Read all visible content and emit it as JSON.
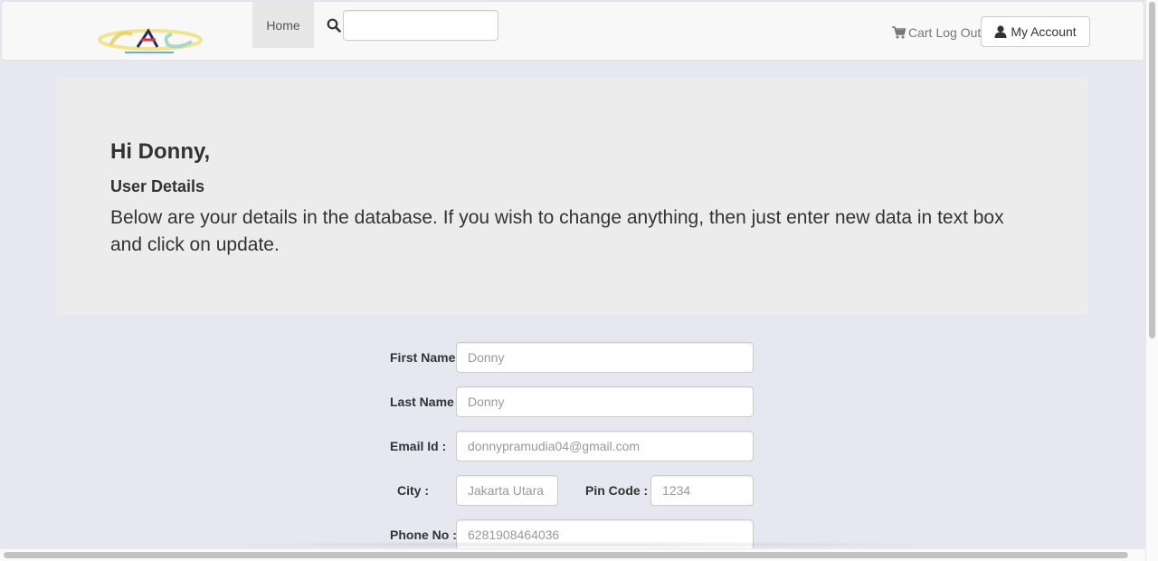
{
  "navbar": {
    "logo_icon": "cac-logo",
    "home_label": "Home",
    "search_icon": "search-icon",
    "search_value": "",
    "cart_label": "Cart",
    "logout_label": "Log Out",
    "account_label": "My Account"
  },
  "jumbotron": {
    "greeting": "Hi Donny,",
    "section_title": "User Details",
    "intro": "Below are your details in the database. If you wish to change anything, then just enter new data in text box and click on update."
  },
  "form": {
    "first_name": {
      "label": "First Name",
      "placeholder": "Donny"
    },
    "last_name": {
      "label": "Last Name",
      "placeholder": "Donny"
    },
    "email": {
      "label": "Email Id :",
      "placeholder": "donnypramudia04@gmail.com"
    },
    "city": {
      "label": "City :",
      "placeholder": "Jakarta Utara"
    },
    "pin_code": {
      "label": "Pin Code :",
      "placeholder": "1234"
    },
    "phone": {
      "label": "Phone No :",
      "placeholder": "6281908464036"
    }
  },
  "colors": {
    "page_background": "#e6e7f1",
    "navbar_background": "#f8f8f8",
    "jumbotron_background": "#ececec"
  }
}
